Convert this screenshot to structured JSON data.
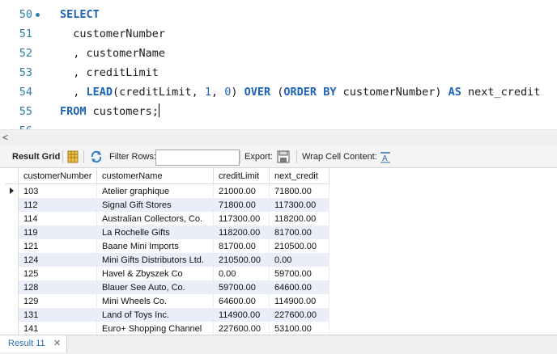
{
  "editor": {
    "lines": [
      {
        "num": "50",
        "parts": [
          {
            "t": "SELECT",
            "k": "kw"
          }
        ]
      },
      {
        "num": "51",
        "parts": [
          {
            "t": "  customerNumber",
            "k": ""
          }
        ]
      },
      {
        "num": "52",
        "parts": [
          {
            "t": "  , customerName",
            "k": ""
          }
        ]
      },
      {
        "num": "53",
        "parts": [
          {
            "t": "  , creditLimit",
            "k": ""
          }
        ]
      },
      {
        "num": "54",
        "parts": [
          {
            "t": "  , ",
            "k": ""
          },
          {
            "t": "LEAD",
            "k": "kw"
          },
          {
            "t": "(creditLimit, ",
            "k": ""
          },
          {
            "t": "1",
            "k": "num"
          },
          {
            "t": ", ",
            "k": ""
          },
          {
            "t": "0",
            "k": "num"
          },
          {
            "t": ") ",
            "k": ""
          },
          {
            "t": "OVER",
            "k": "kw"
          },
          {
            "t": " (",
            "k": ""
          },
          {
            "t": "ORDER BY",
            "k": "kw"
          },
          {
            "t": " customerNumber) ",
            "k": ""
          },
          {
            "t": "AS",
            "k": "kw"
          },
          {
            "t": " next_credit",
            "k": ""
          }
        ]
      },
      {
        "num": "55",
        "parts": [
          {
            "t": "FROM",
            "k": "kw"
          },
          {
            "t": " customers;",
            "k": ""
          }
        ]
      },
      {
        "num": "56",
        "parts": []
      }
    ]
  },
  "toolbar": {
    "result_grid": "Result Grid",
    "filter_rows": "Filter Rows:",
    "filter_value": "",
    "export": "Export:",
    "wrap": "Wrap Cell Content:"
  },
  "grid": {
    "columns": [
      "customerNumber",
      "customerName",
      "creditLimit",
      "next_credit"
    ],
    "rows": [
      [
        "103",
        "Atelier graphique",
        "21000.00",
        "71800.00"
      ],
      [
        "112",
        "Signal Gift Stores",
        "71800.00",
        "117300.00"
      ],
      [
        "114",
        "Australian Collectors, Co.",
        "117300.00",
        "118200.00"
      ],
      [
        "119",
        "La Rochelle Gifts",
        "118200.00",
        "81700.00"
      ],
      [
        "121",
        "Baane Mini Imports",
        "81700.00",
        "210500.00"
      ],
      [
        "124",
        "Mini Gifts Distributors Ltd.",
        "210500.00",
        "0.00"
      ],
      [
        "125",
        "Havel & Zbyszek Co",
        "0.00",
        "59700.00"
      ],
      [
        "128",
        "Blauer See Auto, Co.",
        "59700.00",
        "64600.00"
      ],
      [
        "129",
        "Mini Wheels Co.",
        "64600.00",
        "114900.00"
      ],
      [
        "131",
        "Land of Toys Inc.",
        "114900.00",
        "227600.00"
      ],
      [
        "141",
        "Euro+ Shopping Channel",
        "227600.00",
        "53100.00"
      ]
    ]
  },
  "bottom_tab": {
    "label": "Result 11",
    "close": "✕"
  }
}
